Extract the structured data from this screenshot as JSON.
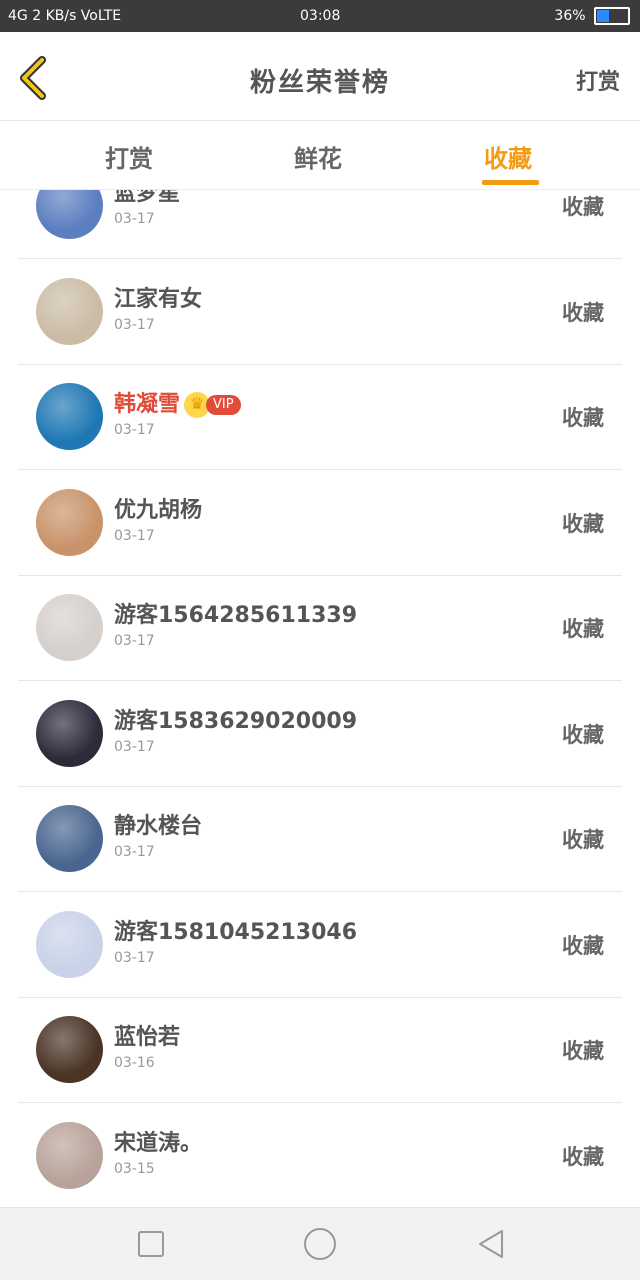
{
  "status_bar": {
    "left": "4G 2 KB/s VoLTE",
    "time": "03:08",
    "battery": "36%",
    "battery_level": 0.36
  },
  "header": {
    "title": "粉丝荣誉榜",
    "right_action": "打赏"
  },
  "tabs": [
    {
      "label": "打赏",
      "active": false
    },
    {
      "label": "鲜花",
      "active": false
    },
    {
      "label": "收藏",
      "active": true
    }
  ],
  "list": [
    {
      "name": "蓝梦星",
      "date": "03-17",
      "action": "收藏",
      "vip": false,
      "avatar_color": "#5b7ec0"
    },
    {
      "name": "江家有女",
      "date": "03-17",
      "action": "收藏",
      "vip": false,
      "avatar_color": "#cbbca5"
    },
    {
      "name": "韩凝雪",
      "date": "03-17",
      "action": "收藏",
      "vip": true,
      "vip_label": "VIP",
      "avatar_color": "#1f78b4"
    },
    {
      "name": "优九胡杨",
      "date": "03-17",
      "action": "收藏",
      "vip": false,
      "avatar_color": "#c9936a"
    },
    {
      "name": "游客1564285611339",
      "date": "03-17",
      "action": "收藏",
      "vip": false,
      "avatar_color": "#d6d0cc"
    },
    {
      "name": "游客1583629020009",
      "date": "03-17",
      "action": "收藏",
      "vip": false,
      "avatar_color": "#2e2a3a"
    },
    {
      "name": "静水楼台",
      "date": "03-17",
      "action": "收藏",
      "vip": false,
      "avatar_color": "#4a6690"
    },
    {
      "name": "游客1581045213046",
      "date": "03-17",
      "action": "收藏",
      "vip": false,
      "avatar_color": "#c9d2e8"
    },
    {
      "name": "蓝怡若",
      "date": "03-16",
      "action": "收藏",
      "vip": false,
      "avatar_color": "#4a3426"
    },
    {
      "name": "宋道涛。",
      "date": "03-15",
      "action": "收藏",
      "vip": false,
      "avatar_color": "#b8a39a"
    }
  ],
  "colors": {
    "accent": "#f39c12",
    "vip": "#e04b3a"
  }
}
